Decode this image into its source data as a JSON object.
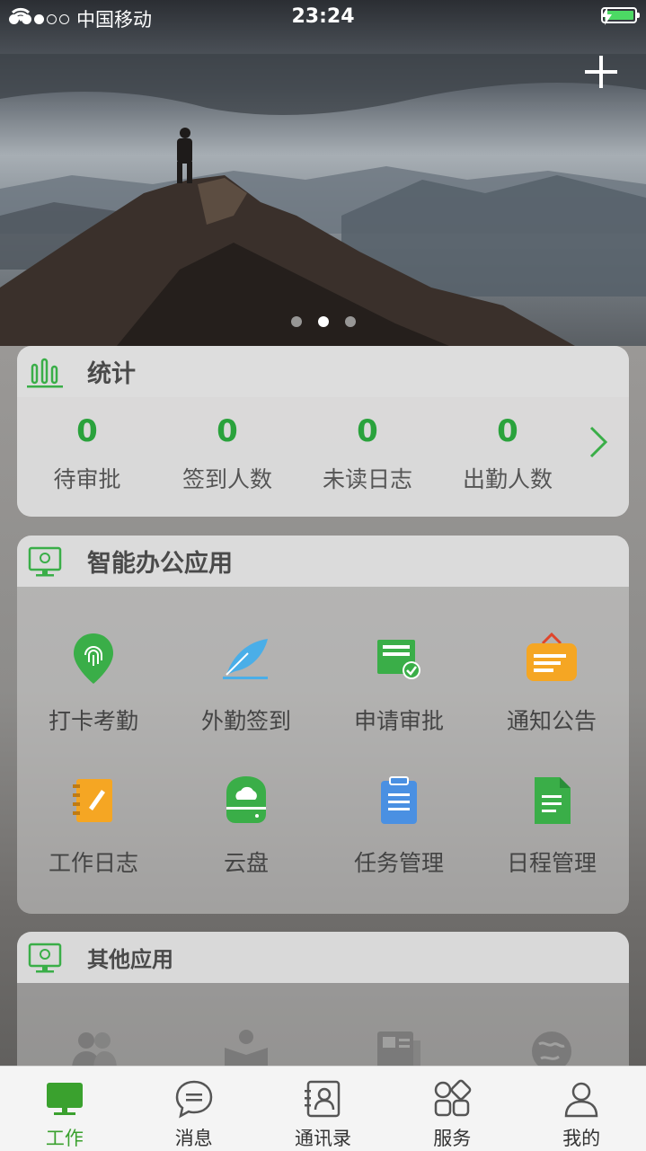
{
  "status_bar": {
    "carrier": "中国移动",
    "time": "23:24"
  },
  "hero": {
    "active_page": 2,
    "page_count": 3
  },
  "stats": {
    "title": "统计",
    "items": [
      {
        "value": "0",
        "label": "待审批"
      },
      {
        "value": "0",
        "label": "签到人数"
      },
      {
        "value": "0",
        "label": "未读日志"
      },
      {
        "value": "0",
        "label": "出勤人数"
      }
    ]
  },
  "smart_apps": {
    "title": "智能办公应用",
    "items": [
      {
        "label": "打卡考勤",
        "icon": "location-fingerprint-icon",
        "color": "#3aae48"
      },
      {
        "label": "外勤签到",
        "icon": "feather-icon",
        "color": "#4aaee8"
      },
      {
        "label": "申请审批",
        "icon": "approval-card-icon",
        "color": "#3aae48"
      },
      {
        "label": "通知公告",
        "icon": "notice-board-icon",
        "color": "#f5a623"
      },
      {
        "label": "工作日志",
        "icon": "notebook-icon",
        "color": "#f5a623"
      },
      {
        "label": "云盘",
        "icon": "cloud-drive-icon",
        "color": "#3aae48"
      },
      {
        "label": "任务管理",
        "icon": "clipboard-icon",
        "color": "#4a90e2"
      },
      {
        "label": "日程管理",
        "icon": "document-icon",
        "color": "#3aae48"
      }
    ]
  },
  "other_apps": {
    "title": "其他应用"
  },
  "tab_bar": {
    "items": [
      {
        "label": "工作",
        "active": true
      },
      {
        "label": "消息",
        "active": false
      },
      {
        "label": "通讯录",
        "active": false
      },
      {
        "label": "服务",
        "active": false
      },
      {
        "label": "我的",
        "active": false
      }
    ]
  },
  "colors": {
    "accent_green": "#3aa12e",
    "stat_green": "#2aa23c"
  }
}
